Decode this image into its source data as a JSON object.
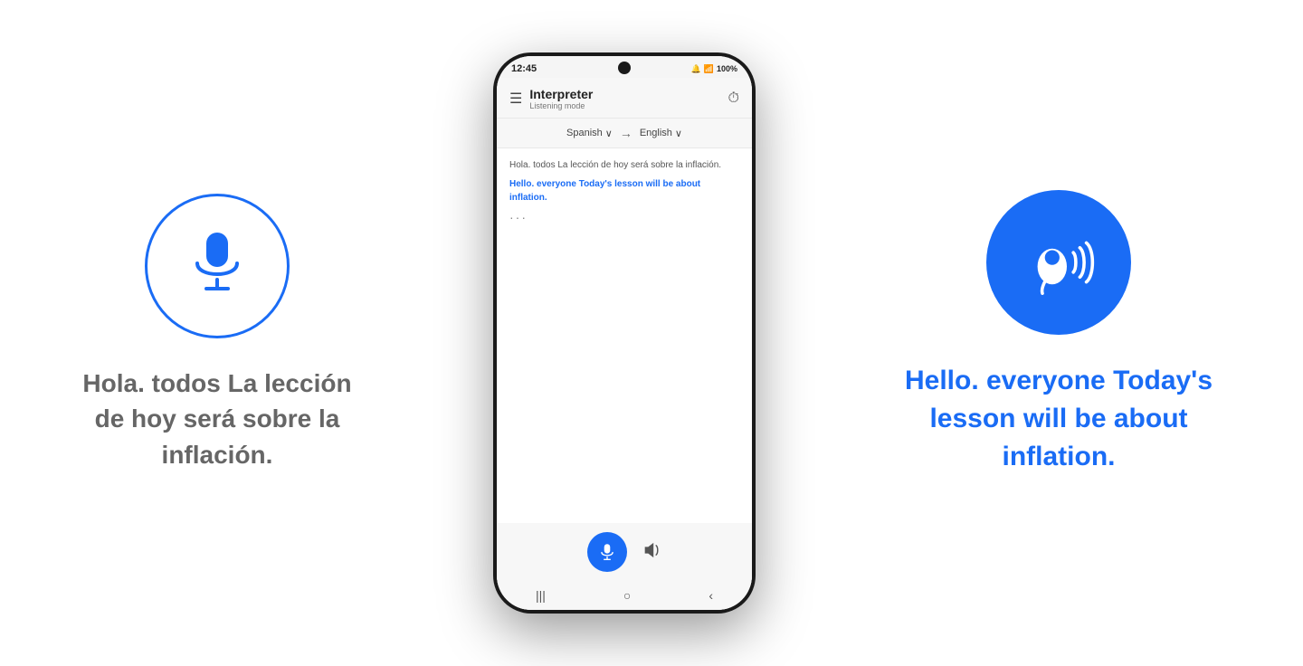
{
  "left": {
    "originalText": "Hola. todos La lección de hoy será sobre la inflación.",
    "micCircleLabel": "microphone circle"
  },
  "phone": {
    "statusBar": {
      "time": "12:45",
      "icons": "🔔 📶 100%"
    },
    "header": {
      "title": "Interpreter",
      "subtitle": "Listening mode",
      "menuIcon": "☰",
      "historyIcon": "🕐"
    },
    "langBar": {
      "sourceLang": "Spanish",
      "arrow": "→",
      "targetLang": "English"
    },
    "conversation": {
      "original": "Hola. todos La lección de hoy será sobre la inflación.",
      "translated": "Hello. everyone Today's lesson will be about inflation.",
      "dots": "···"
    },
    "bottomBar": {
      "micLabel": "microphone button",
      "speakerLabel": "speaker button"
    },
    "navBar": {
      "recentIcon": "|||",
      "homeIcon": "○",
      "backIcon": "‹"
    }
  },
  "right": {
    "translatedText": "Hello. everyone Today's lesson will be about inflation.",
    "earbudLabel": "earbud with sound waves"
  }
}
